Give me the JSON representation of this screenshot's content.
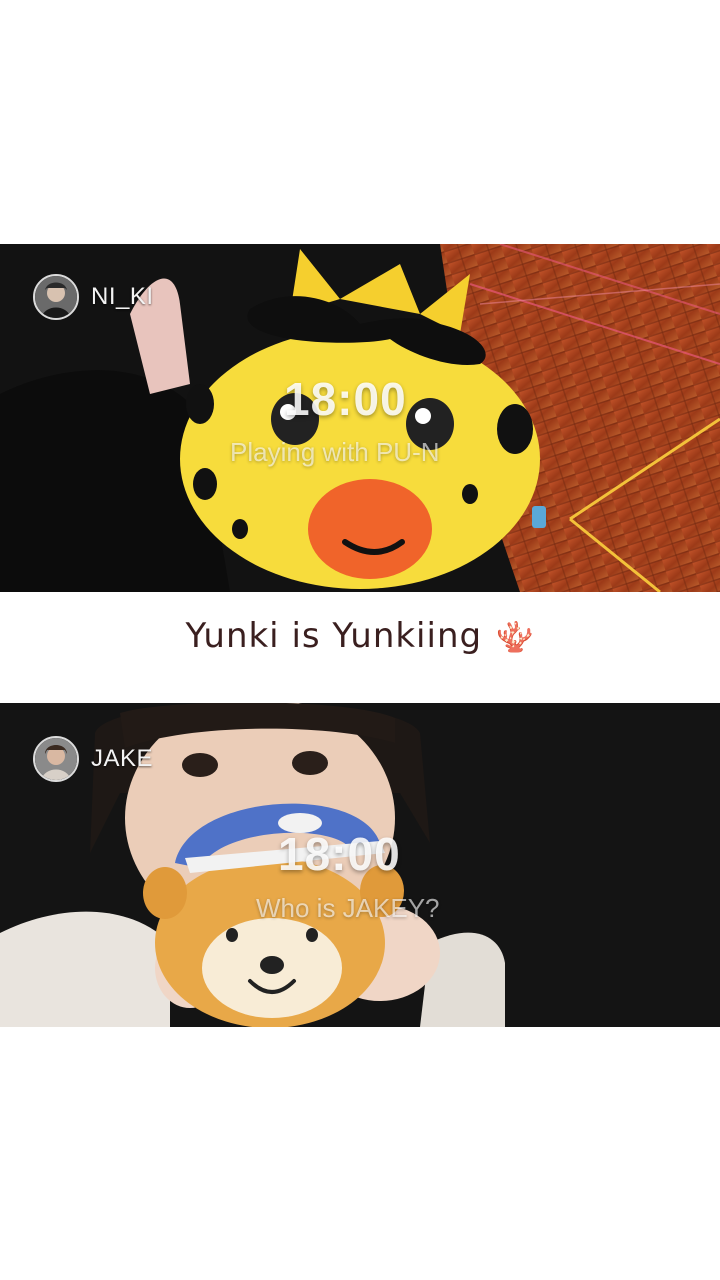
{
  "top_clip": {
    "username": "NI_KI",
    "time": "18:00",
    "subtitle": "Playing with PU-N"
  },
  "caption": {
    "text": "Yunki is Yunkiing",
    "emoji": "🪸"
  },
  "bottom_clip": {
    "username": "JAKE",
    "time": "18:00",
    "subtitle": "Who is JAKEY?"
  },
  "colors": {
    "plush_yellow": "#f7dc3c",
    "beak_orange": "#f0642a",
    "floor_wood": "#a8441f",
    "cap_blue": "#4f72c8",
    "dog_orange": "#e8a848"
  }
}
